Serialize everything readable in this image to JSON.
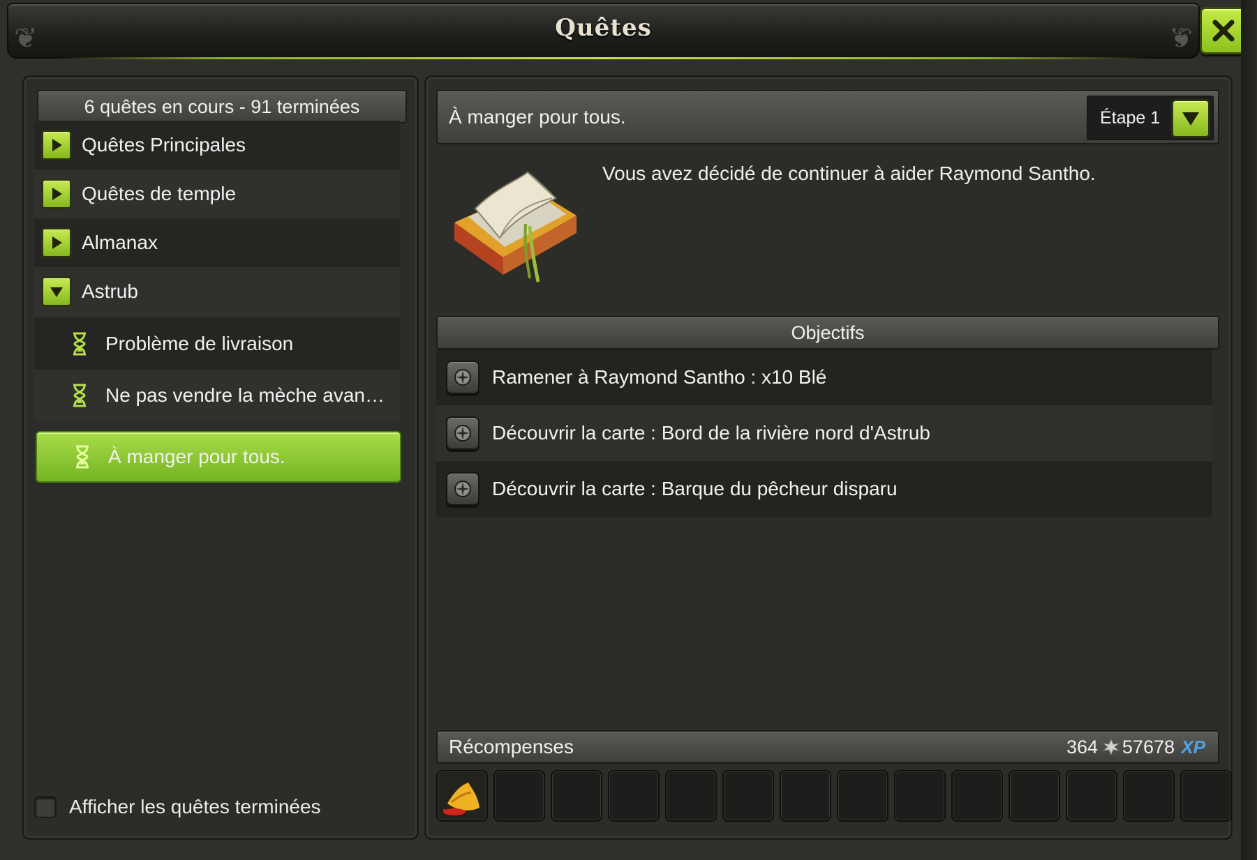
{
  "window": {
    "title": "Quêtes"
  },
  "left": {
    "summary": "6 quêtes en cours - 91 terminées",
    "categories": [
      {
        "label": "Quêtes Principales",
        "state": "collapsed"
      },
      {
        "label": "Quêtes de temple",
        "state": "collapsed"
      },
      {
        "label": "Almanax",
        "state": "collapsed"
      },
      {
        "label": "Astrub",
        "state": "expanded"
      }
    ],
    "quests": [
      {
        "label": "Problème de livraison",
        "icon": "hourglass-icon"
      },
      {
        "label": "Ne pas vendre la mèche avan…",
        "icon": "hourglass-icon"
      },
      {
        "label": "À manger pour tous.",
        "icon": "hourglass-icon",
        "selected": true
      }
    ],
    "show_finished_label": "Afficher les quêtes terminées",
    "show_finished_checked": false
  },
  "detail": {
    "quest_title": "À manger pour tous.",
    "step_label": "Étape 1",
    "description": "Vous avez décidé de continuer à aider Raymond Santho.",
    "objectives_title": "Objectifs",
    "objectives": [
      "Ramener à Raymond Santho : x10 Blé",
      "Découvrir la carte : Bord de la rivière nord d'Astrub",
      "Découvrir la carte : Barque du pêcheur disparu"
    ],
    "rewards_title": "Récompenses",
    "kamas": "364",
    "xp": "57678",
    "xp_badge": "XP"
  },
  "colors": {
    "accent_green": "#a9dc4a",
    "xp_blue": "#4fa3e8"
  }
}
